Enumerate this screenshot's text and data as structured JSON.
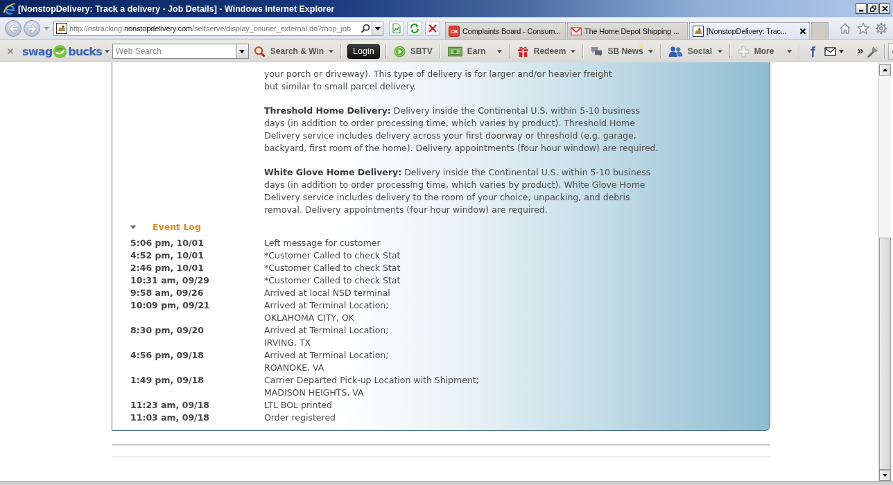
{
  "window": {
    "title": "[NonstopDelivery: Track a delivery - Job Details] - Windows Internet Explorer"
  },
  "address_bar": {
    "scheme": "http://nstracking.",
    "domain": "nonstopdelivery.com",
    "path": "/selfserve/display_courier_external.do?rhop_job"
  },
  "tabs": [
    {
      "label": "Complaints Board - Consum...",
      "icon_text": "CB",
      "selected": false
    },
    {
      "label": "The Home Depot Shipping ...",
      "selected": false
    },
    {
      "label": "[NonstopDelivery: Trac...",
      "selected": true
    }
  ],
  "toolbar": {
    "logo": {
      "left": "swag",
      "right": "bucks"
    },
    "search": {
      "placeholder": "Web Search"
    },
    "items": [
      {
        "kind": "menu",
        "label": "Search & Win",
        "new": false
      },
      {
        "kind": "button",
        "label": "Login",
        "new": false
      },
      {
        "kind": "plain",
        "label": "SBTV",
        "new": false
      },
      {
        "kind": "menu",
        "label": "Earn",
        "new": false
      },
      {
        "kind": "menu",
        "label": "Redeem",
        "new": false
      },
      {
        "kind": "menu",
        "label": "SB News",
        "new": true
      },
      {
        "kind": "menu",
        "label": "Social",
        "new": false
      },
      {
        "kind": "menu",
        "label": "More",
        "new": false
      }
    ]
  },
  "page": {
    "paragraphs": [
      {
        "lines": [
          "your porch or driveway). This type of delivery is for larger and/or heavier freight",
          "but similar to small parcel delivery."
        ]
      },
      {
        "lines": [
          "**Threshold Home Delivery:** Delivery inside the Continental U.S. within 5-10 business",
          "days (in addition to order processing time, which varies by product). Threshold Home",
          "Delivery service includes delivery across your first doorway or threshold (e.g. garage,",
          "backyard, first room of the home). Delivery appointments (four hour window) are required."
        ]
      },
      {
        "lines": [
          "**White Glove Home Delivery:** Delivery inside the Continental U.S. within 5-10 business",
          "days (in addition to order processing time, which varies by product). White Glove Home",
          "Delivery service includes delivery to the room of your choice, unpacking, and debris",
          "removal. Delivery appointments (four hour window) are required."
        ]
      }
    ],
    "event_log": {
      "title": "Event Log",
      "expanded": true,
      "events": [
        {
          "time": "5:06 pm, 10/01",
          "lines": [
            "Left message for customer"
          ]
        },
        {
          "time": "4:52 pm, 10/01",
          "lines": [
            "*Customer Called to check Stat"
          ]
        },
        {
          "time": "2:46 pm, 10/01",
          "lines": [
            "*Customer Called to check Stat"
          ]
        },
        {
          "time": "10:31 am, 09/29",
          "lines": [
            "*Customer Called to check Stat"
          ]
        },
        {
          "time": "9:58 am, 09/26",
          "lines": [
            "Arrived at local NSD terminal"
          ]
        },
        {
          "time": "10:09 pm, 09/21",
          "lines": [
            "Arrived at Terminal Location;",
            "OKLAHOMA CITY, OK"
          ]
        },
        {
          "time": "8:30 pm, 09/20",
          "lines": [
            "Arrived at Terminal Location;",
            "IRVING, TX"
          ]
        },
        {
          "time": "4:56 pm, 09/18",
          "lines": [
            "Arrived at Terminal Location;",
            "ROANOKE, VA"
          ]
        },
        {
          "time": "1:49 pm, 09/18",
          "lines": [
            "Carrier Departed Pick-up Location with Shipment;",
            "MADISON HEIGHTS, VA"
          ]
        },
        {
          "time": "11:23 am, 09/18",
          "lines": [
            "LTL BOL printed"
          ]
        },
        {
          "time": "11:03 am, 09/18",
          "lines": [
            "Order registered"
          ]
        }
      ]
    }
  }
}
